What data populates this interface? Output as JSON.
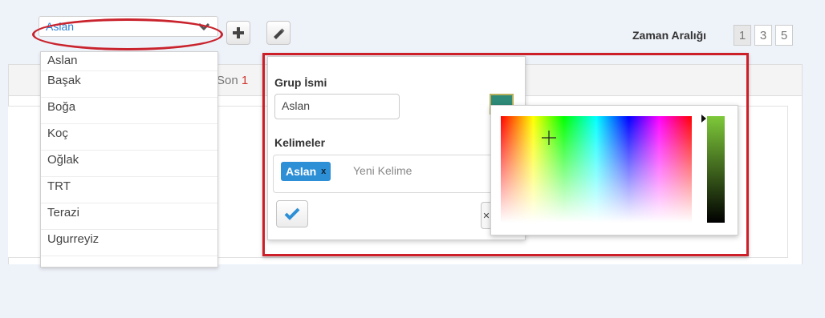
{
  "group_select": {
    "selected": "Aslan",
    "options": [
      "Aslan",
      "Başak",
      "Boğa",
      "Koç",
      "Oğlak",
      "TRT",
      "Terazi",
      "Ugurreyiz"
    ]
  },
  "toolbar": {
    "add_icon": "plus-icon",
    "edit_icon": "pencil-icon"
  },
  "time_range": {
    "label": "Zaman Aralığı",
    "options": [
      "1",
      "3",
      "5"
    ],
    "active": "1"
  },
  "panel": {
    "son_prefix": "Son",
    "son_number": "1"
  },
  "popover": {
    "group_name_label": "Grup İsmi",
    "group_name_value": "Aslan",
    "words_label": "Kelimeler",
    "tag": "Aslan",
    "tag_remove": "x",
    "new_word_placeholder": "Yeni Kelime",
    "color": "#2f8a78",
    "confirm_icon": "check-icon"
  },
  "colors": {
    "accent": "#2d8fd6",
    "highlight": "#cc1f28"
  }
}
